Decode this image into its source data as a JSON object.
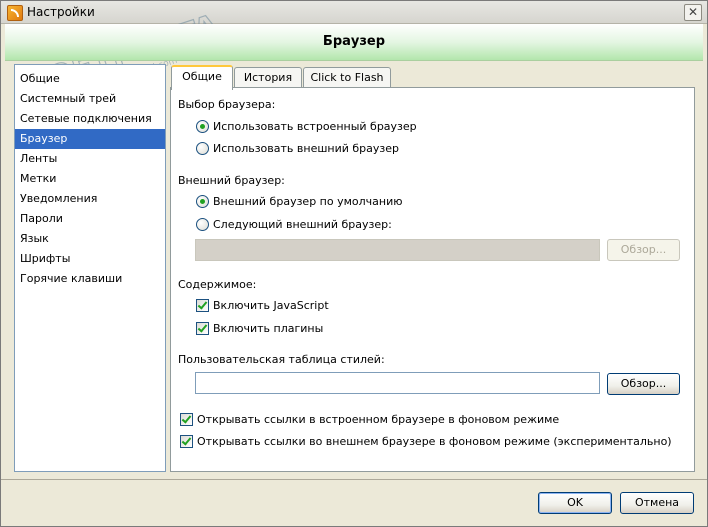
{
  "window": {
    "title": "Настройки",
    "close_glyph": "✕"
  },
  "watermark": {
    "brand": "SOFTPORTAL",
    "url": "www.softportal.com"
  },
  "header": {
    "title": "Браузер"
  },
  "sidebar": {
    "items": [
      {
        "label": "Общие"
      },
      {
        "label": "Системный трей"
      },
      {
        "label": "Сетевые подключения"
      },
      {
        "label": "Браузер",
        "selected": true
      },
      {
        "label": "Ленты"
      },
      {
        "label": "Метки"
      },
      {
        "label": "Уведомления"
      },
      {
        "label": "Пароли"
      },
      {
        "label": "Язык"
      },
      {
        "label": "Шрифты"
      },
      {
        "label": "Горячие клавиши"
      }
    ]
  },
  "tabs": [
    {
      "label": "Общие",
      "active": true
    },
    {
      "label": "История"
    },
    {
      "label": "Click to Flash"
    }
  ],
  "browser_choice": {
    "heading": "Выбор браузера:",
    "options": [
      {
        "label": "Использовать встроенный браузер",
        "checked": true
      },
      {
        "label": "Использовать внешний браузер",
        "checked": false
      }
    ]
  },
  "external_browser": {
    "heading": "Внешний браузер:",
    "options": [
      {
        "label": "Внешний браузер по умолчанию",
        "checked": true
      },
      {
        "label": "Следующий внешний браузер:",
        "checked": false
      }
    ],
    "path_value": "",
    "browse_label": "Обзор..."
  },
  "content": {
    "heading": "Содержимое:",
    "options": [
      {
        "label": "Включить JavaScript",
        "checked": true
      },
      {
        "label": "Включить плагины",
        "checked": true
      }
    ]
  },
  "stylesheet": {
    "heading": "Пользовательская таблица стилей:",
    "value": "",
    "browse_label": "Обзор..."
  },
  "links": {
    "options": [
      {
        "label": "Открывать ссылки в встроенном браузере в фоновом режиме",
        "checked": true
      },
      {
        "label": "Открывать ссылки во внешнем браузере в фоновом режиме (экспериментально)",
        "checked": true
      }
    ]
  },
  "footer": {
    "ok_label": "OK",
    "cancel_label": "Отмена"
  },
  "colors": {
    "header_green": "#b3e6ac",
    "selection": "#316ac5",
    "check_green": "#21a121"
  }
}
